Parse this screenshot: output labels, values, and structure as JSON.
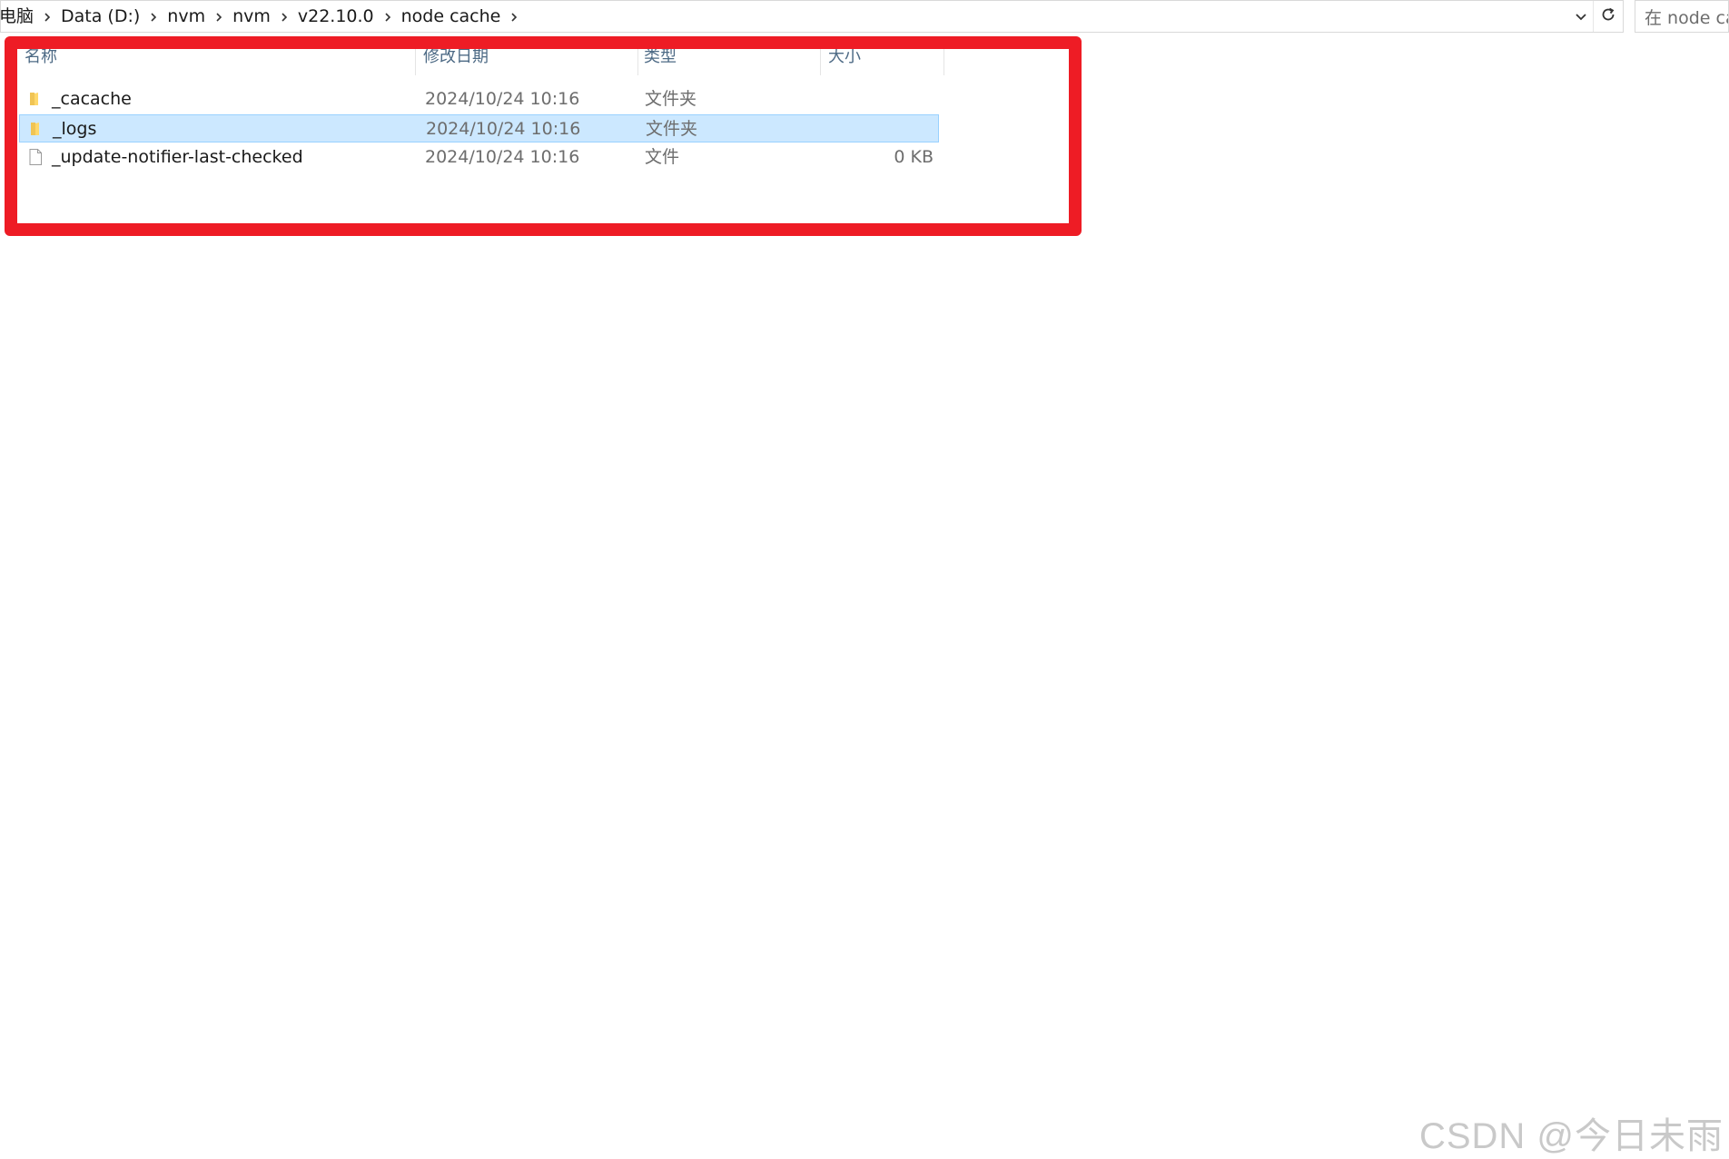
{
  "breadcrumb": {
    "items": [
      "电脑",
      "Data (D:)",
      "nvm",
      "nvm",
      "v22.10.0",
      "node cache"
    ]
  },
  "search": {
    "placeholder": "在 node ca"
  },
  "columns": {
    "name": "名称",
    "date": "修改日期",
    "type": "类型",
    "size": "大小"
  },
  "files": [
    {
      "name": "_cacache",
      "date": "2024/10/24 10:16",
      "type": "文件夹",
      "size": "",
      "icon": "folder-icon",
      "selected": false
    },
    {
      "name": "_logs",
      "date": "2024/10/24 10:16",
      "type": "文件夹",
      "size": "",
      "icon": "folder-icon",
      "selected": true
    },
    {
      "name": "_update-notifier-last-checked",
      "date": "2024/10/24 10:16",
      "type": "文件",
      "size": "0 KB",
      "icon": "file-icon",
      "selected": false
    }
  ],
  "watermark": {
    "csdn": "CSDN @今日未雨"
  },
  "colors": {
    "selection_bg": "#cce8ff",
    "selection_border": "#99d1ff",
    "annotation_red": "#ee1c25",
    "header_text": "#4d6a85"
  }
}
